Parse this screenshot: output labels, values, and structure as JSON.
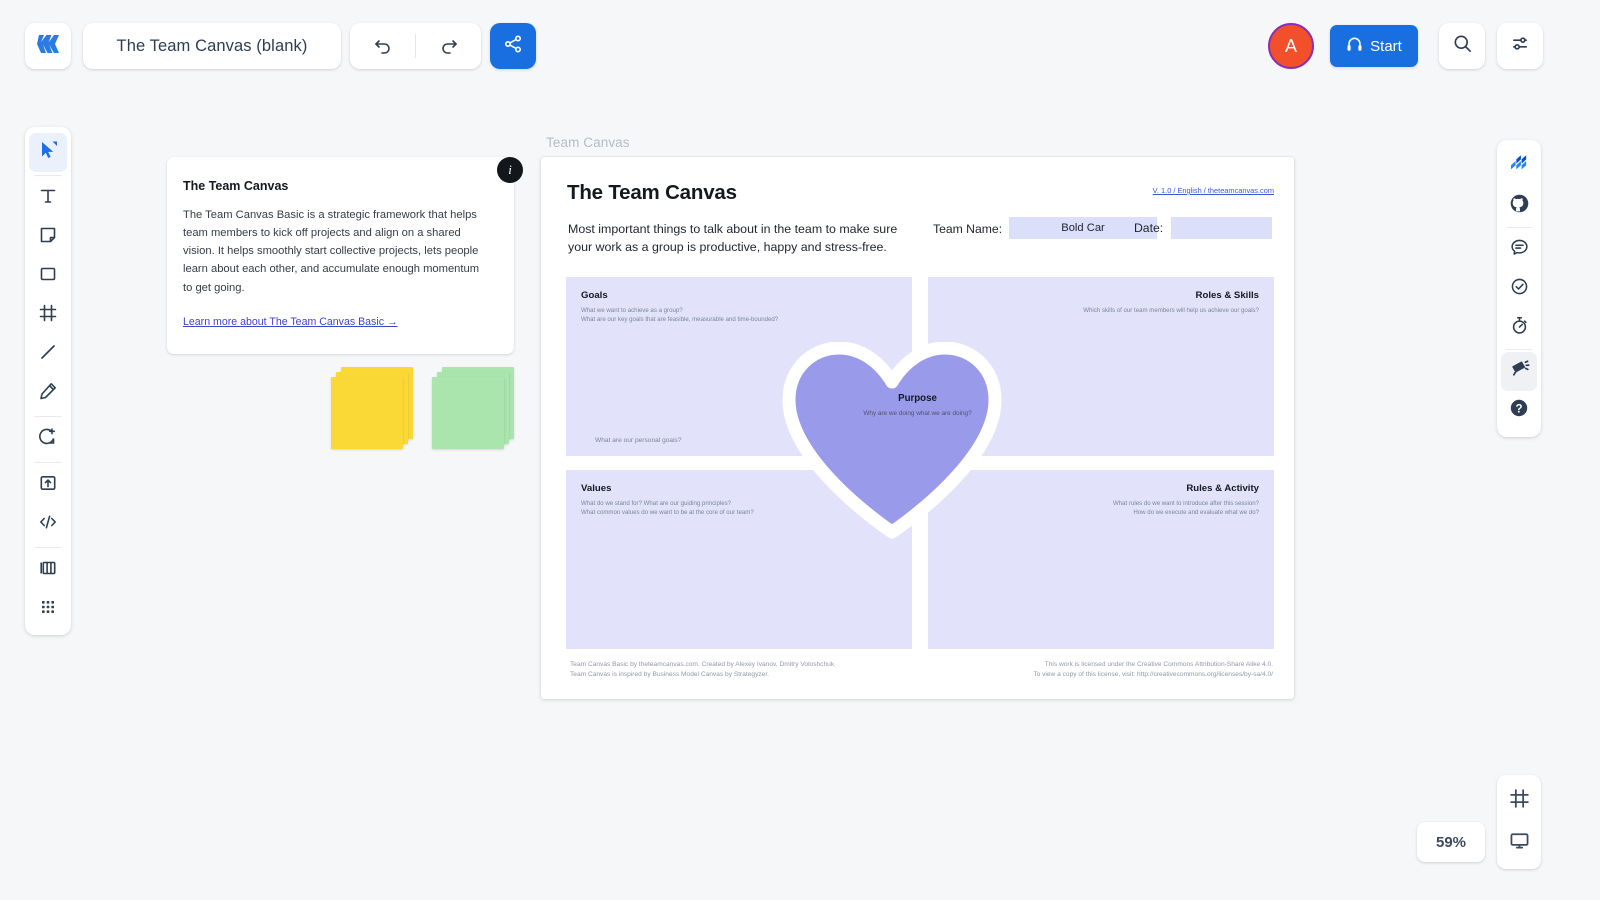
{
  "app": {
    "logo_icon": "miro-logo-icon",
    "board_title": "The Team Canvas (blank)"
  },
  "toolbar_top": {
    "undo_icon": "undo-arrow-icon",
    "redo_icon": "redo-arrow-icon",
    "share_icon": "share-nodes-icon",
    "avatar_initial": "A",
    "start_label": "Start",
    "start_icon": "headset-icon",
    "search_icon": "search-icon",
    "settings_icon": "sliders-icon"
  },
  "left_toolbar": {
    "items": [
      {
        "name": "select-tool",
        "icon": "cursor-arrow-icon",
        "active": true
      },
      {
        "name": "text-tool",
        "icon": "text-t-icon",
        "active": false
      },
      {
        "name": "sticky-tool",
        "icon": "sticky-note-icon",
        "active": false
      },
      {
        "name": "shape-tool",
        "icon": "rectangle-icon",
        "active": false
      },
      {
        "name": "frame-tool",
        "icon": "frame-icon",
        "active": false
      },
      {
        "name": "line-tool",
        "icon": "line-icon",
        "active": false
      },
      {
        "name": "pen-tool",
        "icon": "pencil-icon",
        "active": false
      },
      {
        "name": "comment-tool",
        "icon": "comment-plus-icon",
        "active": false
      },
      {
        "name": "upload-tool",
        "icon": "upload-box-icon",
        "active": false
      },
      {
        "name": "embed-tool",
        "icon": "code-brackets-icon",
        "active": false
      },
      {
        "name": "template-tool",
        "icon": "columns-icon",
        "active": false
      },
      {
        "name": "apps-tool",
        "icon": "grid-dots-icon",
        "active": false
      }
    ]
  },
  "right_toolbar": {
    "items": [
      {
        "name": "jira-app",
        "icon": "jira-icon",
        "active": false
      },
      {
        "name": "github-app",
        "icon": "github-icon",
        "active": false
      },
      {
        "name": "chat-panel",
        "icon": "chat-bubble-icon",
        "active": false
      },
      {
        "name": "vote-panel",
        "icon": "check-circle-icon",
        "active": false
      },
      {
        "name": "timer-panel",
        "icon": "stopwatch-icon",
        "active": false
      },
      {
        "name": "attention-panel",
        "icon": "megaphone-icon",
        "active": true
      },
      {
        "name": "help-panel",
        "icon": "help-circle-icon",
        "active": false
      }
    ]
  },
  "info_card": {
    "badge_icon": "info-icon",
    "title": "The Team Canvas",
    "body": "The Team Canvas Basic is a strategic framework that helps team members to kick off projects and align on a shared vision. It helps smoothly start collective projects, lets people learn about each other, and accumulate enough momentum to get going.",
    "link": "Learn more about The Team Canvas Basic →"
  },
  "stickies": [
    {
      "name": "sticky-stack-yellow",
      "color": "#fad836"
    },
    {
      "name": "sticky-stack-green",
      "color": "#a9e5ac"
    }
  ],
  "canvas": {
    "frame_label": "Team Canvas",
    "board": {
      "title": "The Team Canvas",
      "version_link": "V. 1.0 / English / theteamcanvas.com",
      "subtitle": "Most important things to talk about in the team to make sure your work as a group is productive, happy and stress-free.",
      "team_name_label": "Team Name:",
      "team_name_value": "Bold Car",
      "date_label": "Date:",
      "date_value": "",
      "quadrants": {
        "goals": {
          "title": "Goals",
          "questions": [
            "What we want to achieve as a group?",
            "What are our key goals that are feasible, measurable and time-bounded?"
          ],
          "extra": "What are our personal goals?"
        },
        "roles": {
          "title": "Roles & Skills",
          "questions": [
            "Which skills of our team members will help us achieve our goals?"
          ]
        },
        "values": {
          "title": "Values",
          "questions": [
            "What do we stand for? What are our guiding principles?",
            "What common values do we want to be at the core of our team?"
          ]
        },
        "rules": {
          "title": "Rules & Activity",
          "questions": [
            "What rules do we want to introduce after this session?",
            "How do we execute and evaluate what we do?"
          ]
        }
      },
      "center": {
        "title": "Purpose",
        "question": "Why are we doing what we are doing?"
      },
      "footer_left_line1": "Team Canvas Basic by theteamcanvas.com. Created by Alexey Ivanov, Dmitry Voloshchuk",
      "footer_left_line2": "Team Canvas is inspired by Business Model Canvas by Strategyzer.",
      "footer_right_line1": "This work is licensed under the Creative Commons Attribution-Share Alike 4.0.",
      "footer_right_line2": "To view a copy of this license, visit: http://creativecommons.org/licenses/by-sa/4.0/"
    }
  },
  "view": {
    "zoom_level": "59%",
    "fit_icon": "frame-fit-icon",
    "presentation_icon": "monitor-icon"
  },
  "colors": {
    "accent_blue": "#1a6fe0",
    "quadrant_fill": "#e2e3fb",
    "heart_fill": "#9a9aeb",
    "avatar_fill": "#f1502a",
    "avatar_ring": "#8b2fb0"
  }
}
